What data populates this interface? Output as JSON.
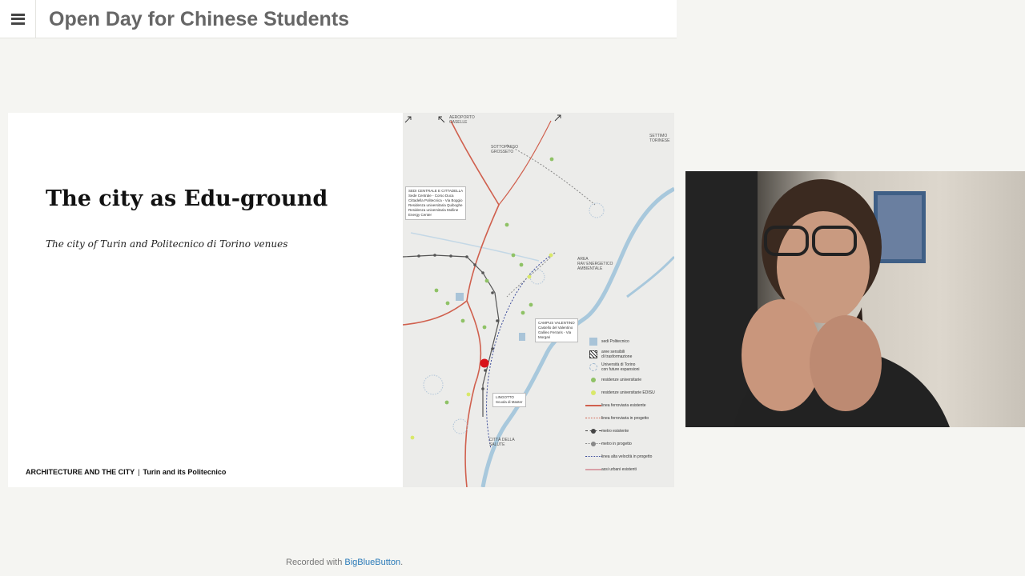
{
  "header": {
    "menu_icon": "hamburger-icon",
    "title": "Open Day for Chinese Students"
  },
  "slide": {
    "heading": "The city as Edu-ground",
    "subheading": "The city of Turin and Politecnico di Torino venues",
    "footer_left": "ARCHITECTURE AND THE CITY",
    "footer_sep": "|",
    "footer_right": "Turin and its Politecnico"
  },
  "map": {
    "labels": {
      "aeroporto": "AEROPORTO\nCASELLE",
      "sottopasso": "SOTTOPASSO\nGROSSETO",
      "settimo": "SETTIMO\nTORINESE",
      "area_rav": "AREA\nRAV ENERGETICO\nAMBIENTALE",
      "citta_salute": "CITTÀ DELLA\nSALUTE"
    },
    "box_sedi": [
      "SEDI CENTRALE E CITTADELLA",
      "Sede Centrale - Corso Duca",
      "Cittadella Politecnica - Via Boggio",
      "Residenza universitaria Quiboghe",
      "Residenza universitaria Molline",
      "Energy Center"
    ],
    "box_campus": [
      "CAMPUS VALENTINO",
      "Castello del Valentino",
      "Galileo Ferraris - Via",
      "Morgari"
    ],
    "box_lingotto": [
      "LINGOTTO",
      "Scuola di Master"
    ],
    "legend": [
      {
        "symbol": "square",
        "text": "sedi Politecnico"
      },
      {
        "symbol": "hatch",
        "text": "aree sensibili\ndi trasformazione"
      },
      {
        "symbol": "dashed-circle",
        "text": "Università di Torino\ncon future espansioni"
      },
      {
        "symbol": "green-dot",
        "text": "residenze universitarie"
      },
      {
        "symbol": "yellow-dot",
        "text": "residenze universitarie EDISU"
      },
      {
        "symbol": "red-line",
        "text": "linea ferroviaria esistente"
      },
      {
        "symbol": "red-dotted",
        "text": "linea ferroviaria in progetto"
      },
      {
        "symbol": "dark-metro",
        "text": "metro esistente"
      },
      {
        "symbol": "grey-metro",
        "text": "metro in progetto"
      },
      {
        "symbol": "blue-dotted",
        "text": "linea alta velocità in progetto"
      },
      {
        "symbol": "pink-line",
        "text": "assi urbani esistenti"
      }
    ],
    "colors": {
      "rail": "#d0604e",
      "river": "#a8c8dc",
      "metro": "#555555",
      "green": "#8fc266",
      "yellow": "#d9e86a",
      "poli": "#a9c4d8",
      "highspeed": "#3a4a9a"
    }
  },
  "footer": {
    "recorded_prefix": "Recorded with ",
    "recorded_link": "BigBlueButton",
    "recorded_suffix": "."
  }
}
